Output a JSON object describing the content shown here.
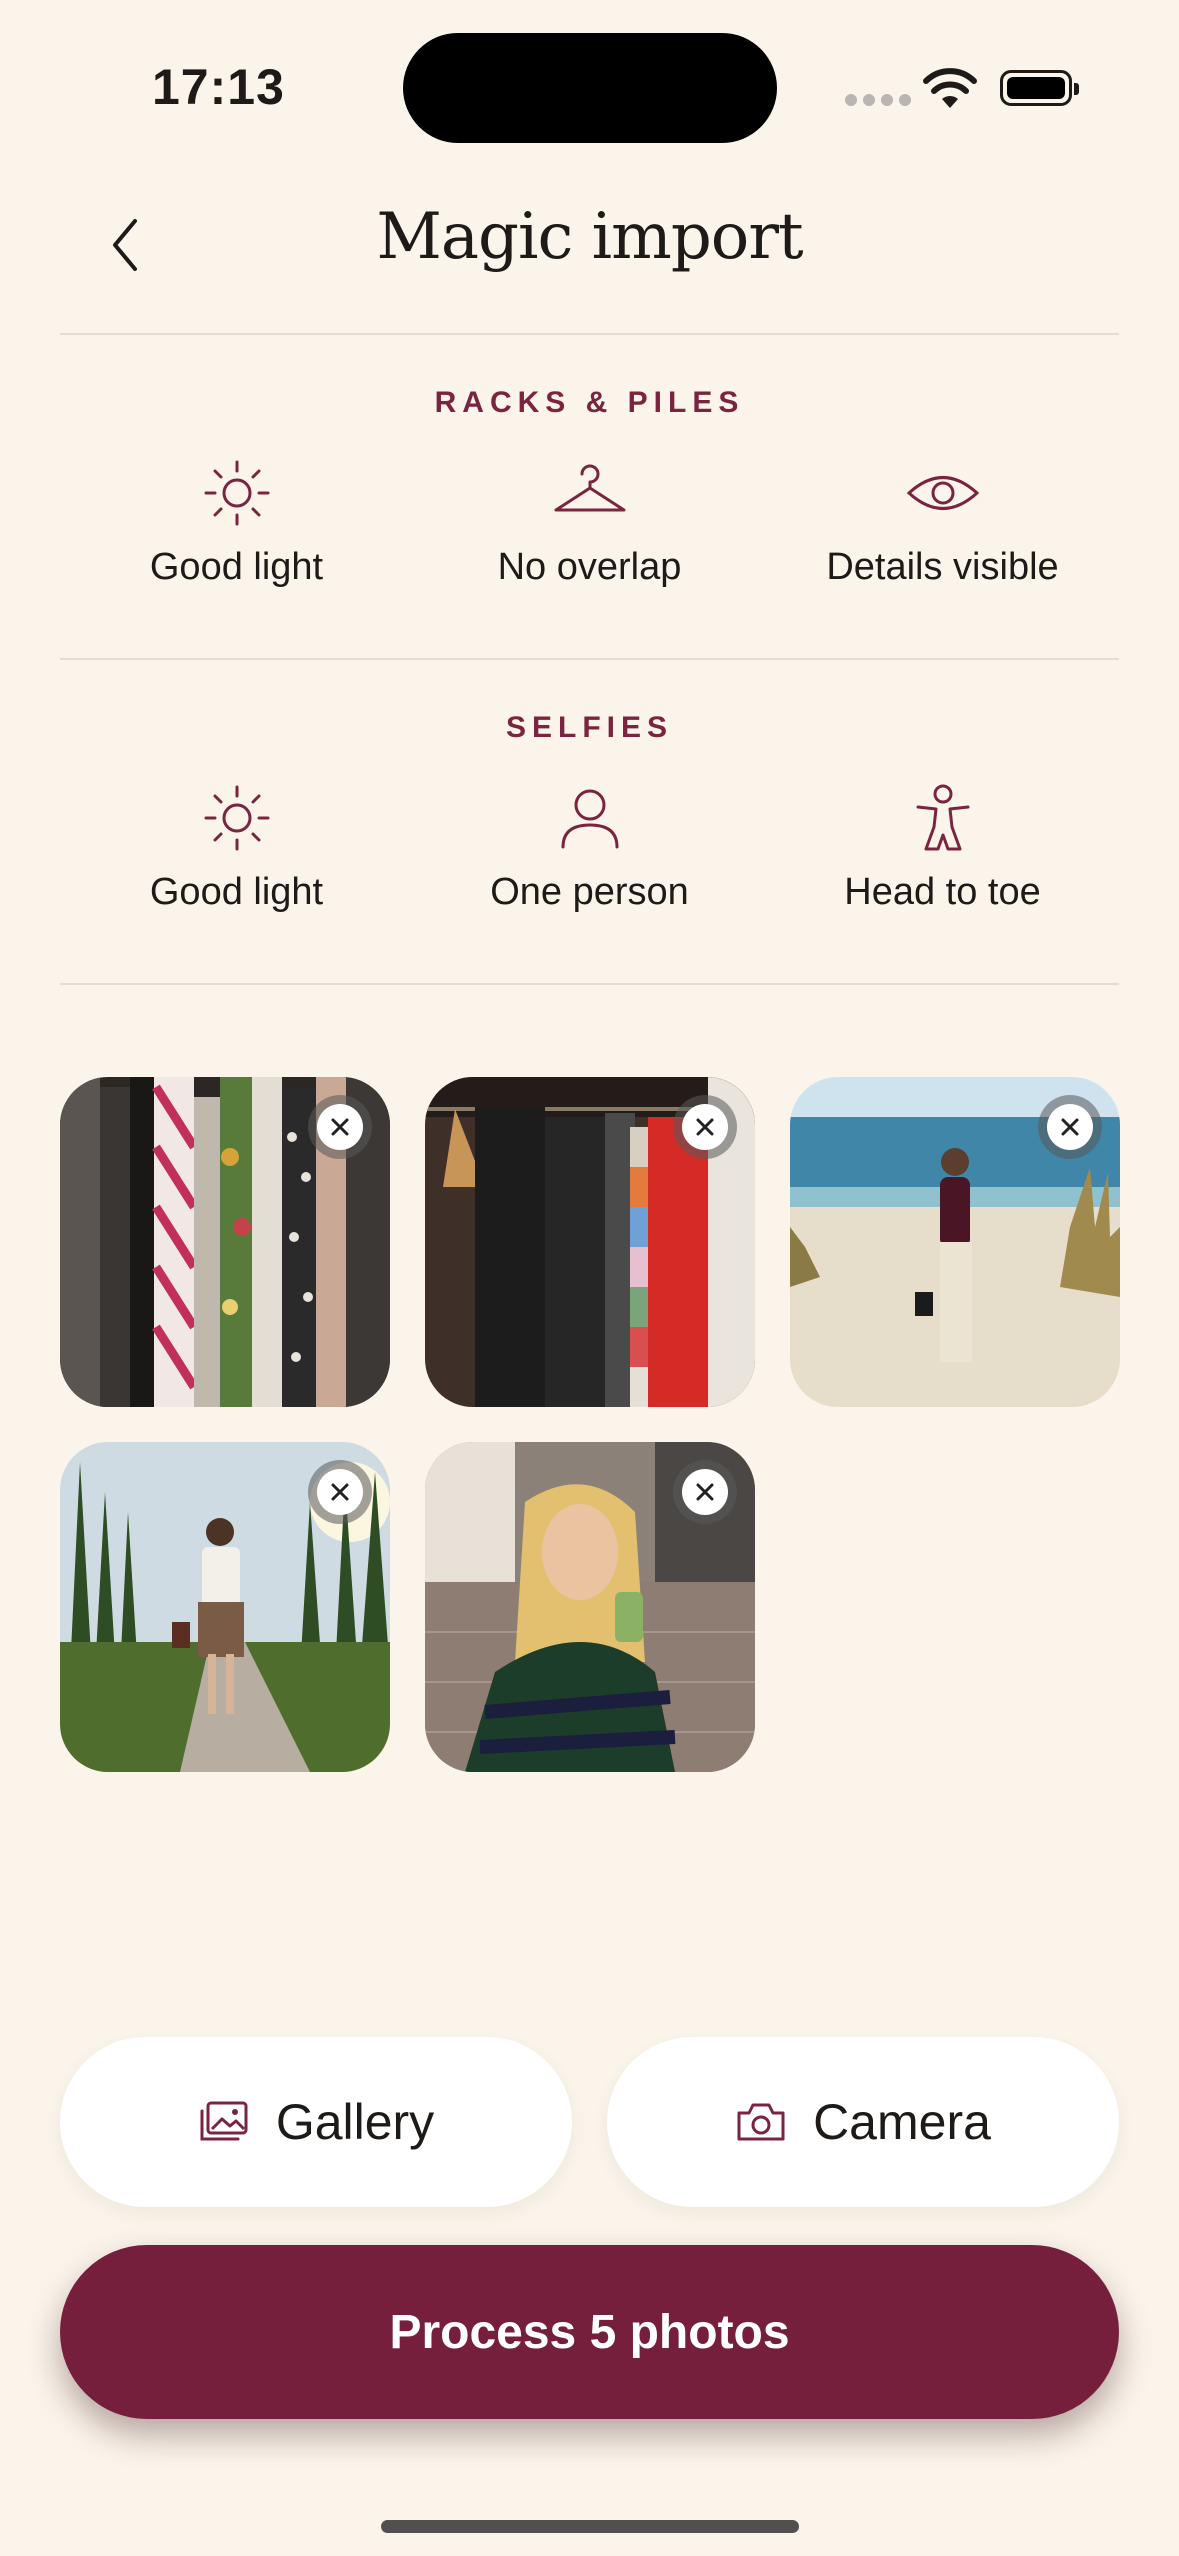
{
  "status_bar": {
    "time": "17:13"
  },
  "header": {
    "title": "Magic import",
    "back_icon": "chevron-left-icon"
  },
  "sections": [
    {
      "title": "RACKS & PILES",
      "tips": [
        {
          "label": "Good light",
          "icon": "sun-icon"
        },
        {
          "label": "No overlap",
          "icon": "hanger-icon"
        },
        {
          "label": "Details visible",
          "icon": "eye-icon"
        }
      ]
    },
    {
      "title": "SELFIES",
      "tips": [
        {
          "label": "Good light",
          "icon": "sun-icon"
        },
        {
          "label": "One person",
          "icon": "person-icon"
        },
        {
          "label": "Head to toe",
          "icon": "full-body-icon"
        }
      ]
    }
  ],
  "photos": [
    {
      "id": "rack-1",
      "remove_icon": "close-icon"
    },
    {
      "id": "rack-2",
      "remove_icon": "close-icon"
    },
    {
      "id": "beach-selfie",
      "remove_icon": "close-icon"
    },
    {
      "id": "garden-selfie",
      "remove_icon": "close-icon"
    },
    {
      "id": "street-selfie",
      "remove_icon": "close-icon"
    }
  ],
  "actions": {
    "gallery_label": "Gallery",
    "gallery_icon": "image-icon",
    "camera_label": "Camera",
    "camera_icon": "camera-icon",
    "process_label": "Process 5 photos"
  },
  "colors": {
    "background": "#faf4ea",
    "accent": "#761f3c",
    "section_title": "#7a2440",
    "icon": "#7a2440"
  }
}
